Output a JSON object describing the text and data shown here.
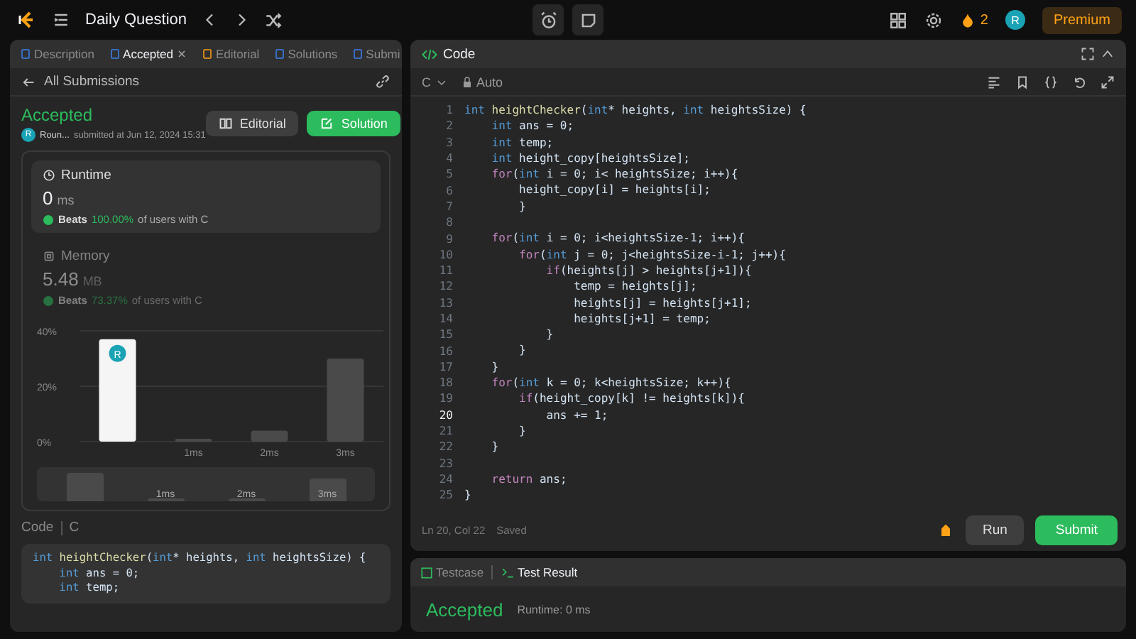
{
  "topbar": {
    "title": "Daily Question",
    "streak": "2",
    "avatar": "R",
    "premium": "Premium"
  },
  "left_panel": {
    "tabs": [
      {
        "label": "Description",
        "selected": false,
        "closable": false
      },
      {
        "label": "Accepted",
        "selected": true,
        "closable": true
      },
      {
        "label": "Editorial",
        "selected": false,
        "closable": false
      },
      {
        "label": "Solutions",
        "selected": false,
        "closable": false
      },
      {
        "label": "Submi",
        "selected": false,
        "closable": false
      }
    ],
    "back_link": "All Submissions",
    "submission": {
      "status": "Accepted",
      "author_avatar": "R",
      "author": "Roun...",
      "submitted": "submitted at Jun 12, 2024 15:31",
      "buttons": [
        {
          "kind": "editorial",
          "label": "Editorial"
        },
        {
          "kind": "solution",
          "label": "Solution"
        }
      ]
    },
    "stats": [
      {
        "kind": "runtime",
        "title": "Runtime",
        "value": "0",
        "unit": "ms",
        "beats": "Beats",
        "percent": "100.00%",
        "suffix": "of users with C",
        "selected": true
      },
      {
        "kind": "memory",
        "title": "Memory",
        "value": "5.48",
        "unit": "MB",
        "beats": "Beats",
        "percent": "73.37%",
        "suffix": "of users with C",
        "selected": false
      }
    ],
    "chart": {
      "marker_avatar": "R",
      "bars": [
        {
          "selected": true
        },
        {
          "selected": false
        },
        {
          "selected": false
        },
        {
          "selected": false
        }
      ],
      "overview_labels": [
        "1ms",
        "2ms",
        "3ms"
      ],
      "chart_data": {
        "type": "bar",
        "categories": [
          null,
          "1ms",
          "2ms",
          "3ms"
        ],
        "values": [
          37,
          1,
          4,
          30
        ],
        "ylim": [
          0,
          40
        ],
        "yticks": [
          {
            "value": 0,
            "label": "0%"
          },
          {
            "value": 20,
            "label": "20%"
          },
          {
            "value": 40,
            "label": "40%"
          }
        ]
      }
    },
    "code_preview": {
      "label": "Code",
      "language": "C",
      "lines": [
        {
          "tokens": [
            {
              "kind": "type",
              "text": "int"
            },
            {
              "kind": "fn",
              "text": " heightChecker"
            },
            {
              "kind": "plain",
              "text": "("
            },
            {
              "kind": "type",
              "text": "int"
            },
            {
              "kind": "plain",
              "text": "* heights, "
            },
            {
              "kind": "type",
              "text": "int"
            },
            {
              "kind": "plain",
              "text": " heightsSize) {"
            }
          ]
        },
        {
          "tokens": [
            {
              "kind": "type",
              "text": "    int"
            },
            {
              "kind": "plain",
              "text": " ans = 0;"
            }
          ]
        },
        {
          "tokens": [
            {
              "kind": "type",
              "text": "    int"
            },
            {
              "kind": "plain",
              "text": " temp;"
            }
          ]
        }
      ]
    }
  },
  "editor": {
    "title": "Code",
    "language": "C",
    "mode": "Auto",
    "status": "Ln 20, Col 22",
    "saved": "Saved",
    "run": "Run",
    "submit": "Submit",
    "lines": [
      {
        "n": "1",
        "current": false,
        "tokens": [
          {
            "kind": "type",
            "text": "int"
          },
          {
            "kind": "fn",
            "text": " heightChecker"
          },
          {
            "kind": "plain",
            "text": "("
          },
          {
            "kind": "type",
            "text": "int"
          },
          {
            "kind": "plain",
            "text": "* heights, "
          },
          {
            "kind": "type",
            "text": "int"
          },
          {
            "kind": "plain",
            "text": " heightsSize) {"
          }
        ]
      },
      {
        "n": "2",
        "current": false,
        "tokens": [
          {
            "kind": "type",
            "text": "    int"
          },
          {
            "kind": "plain",
            "text": " ans = 0;"
          }
        ]
      },
      {
        "n": "3",
        "current": false,
        "tokens": [
          {
            "kind": "type",
            "text": "    int"
          },
          {
            "kind": "plain",
            "text": " temp;"
          }
        ]
      },
      {
        "n": "4",
        "current": false,
        "tokens": [
          {
            "kind": "type",
            "text": "    int"
          },
          {
            "kind": "plain",
            "text": " height_copy[heightsSize];"
          }
        ]
      },
      {
        "n": "5",
        "current": false,
        "tokens": [
          {
            "kind": "ctrl",
            "text": "    for"
          },
          {
            "kind": "plain",
            "text": "("
          },
          {
            "kind": "type",
            "text": "int"
          },
          {
            "kind": "plain",
            "text": " i = 0; i< heightsSize; i++){"
          }
        ]
      },
      {
        "n": "6",
        "current": false,
        "tokens": [
          {
            "kind": "plain",
            "text": "        height_copy[i] = heights[i];"
          }
        ]
      },
      {
        "n": "7",
        "current": false,
        "tokens": [
          {
            "kind": "plain",
            "text": "        }"
          }
        ]
      },
      {
        "n": "8",
        "current": false
      },
      {
        "n": "9",
        "current": false,
        "tokens": [
          {
            "kind": "ctrl",
            "text": "    for"
          },
          {
            "kind": "plain",
            "text": "("
          },
          {
            "kind": "type",
            "text": "int"
          },
          {
            "kind": "plain",
            "text": " i = 0; i<heightsSize-1; i++){"
          }
        ]
      },
      {
        "n": "10",
        "current": false,
        "tokens": [
          {
            "kind": "ctrl",
            "text": "        for"
          },
          {
            "kind": "plain",
            "text": "("
          },
          {
            "kind": "type",
            "text": "int"
          },
          {
            "kind": "plain",
            "text": " j = 0; j<heightsSize-i-1; j++){"
          }
        ]
      },
      {
        "n": "11",
        "current": false,
        "tokens": [
          {
            "kind": "ctrl",
            "text": "            if"
          },
          {
            "kind": "plain",
            "text": "(heights[j] > heights[j+1]){"
          }
        ]
      },
      {
        "n": "12",
        "current": false,
        "tokens": [
          {
            "kind": "plain",
            "text": "                temp = heights[j];"
          }
        ]
      },
      {
        "n": "13",
        "current": false,
        "tokens": [
          {
            "kind": "plain",
            "text": "                heights[j] = heights[j+1];"
          }
        ]
      },
      {
        "n": "14",
        "current": false,
        "tokens": [
          {
            "kind": "plain",
            "text": "                heights[j+1] = temp;"
          }
        ]
      },
      {
        "n": "15",
        "current": false,
        "tokens": [
          {
            "kind": "plain",
            "text": "            }"
          }
        ]
      },
      {
        "n": "16",
        "current": false,
        "tokens": [
          {
            "kind": "plain",
            "text": "        }"
          }
        ]
      },
      {
        "n": "17",
        "current": false,
        "tokens": [
          {
            "kind": "plain",
            "text": "    }"
          }
        ]
      },
      {
        "n": "18",
        "current": false,
        "tokens": [
          {
            "kind": "ctrl",
            "text": "    for"
          },
          {
            "kind": "plain",
            "text": "("
          },
          {
            "kind": "type",
            "text": "int"
          },
          {
            "kind": "plain",
            "text": " k = 0; k<heightsSize; k++){"
          }
        ]
      },
      {
        "n": "19",
        "current": false,
        "tokens": [
          {
            "kind": "ctrl",
            "text": "        if"
          },
          {
            "kind": "plain",
            "text": "(height_copy[k] != heights[k]){"
          }
        ]
      },
      {
        "n": "20",
        "current": true,
        "tokens": [
          {
            "kind": "plain",
            "text": "            ans += 1;"
          }
        ]
      },
      {
        "n": "21",
        "current": false,
        "tokens": [
          {
            "kind": "plain",
            "text": "        }"
          }
        ]
      },
      {
        "n": "22",
        "current": false,
        "tokens": [
          {
            "kind": "plain",
            "text": "    }"
          }
        ]
      },
      {
        "n": "23",
        "current": false
      },
      {
        "n": "24",
        "current": false,
        "tokens": [
          {
            "kind": "ctrl",
            "text": "    return"
          },
          {
            "kind": "plain",
            "text": " ans;"
          }
        ]
      },
      {
        "n": "25",
        "current": false,
        "tokens": [
          {
            "kind": "plain",
            "text": "}"
          }
        ]
      }
    ]
  },
  "console": {
    "tabs": [
      {
        "label": "Testcase",
        "selected": false
      },
      {
        "label": "Test Result",
        "selected": true
      }
    ],
    "result": "Accepted",
    "runtime": "Runtime: 0 ms"
  }
}
